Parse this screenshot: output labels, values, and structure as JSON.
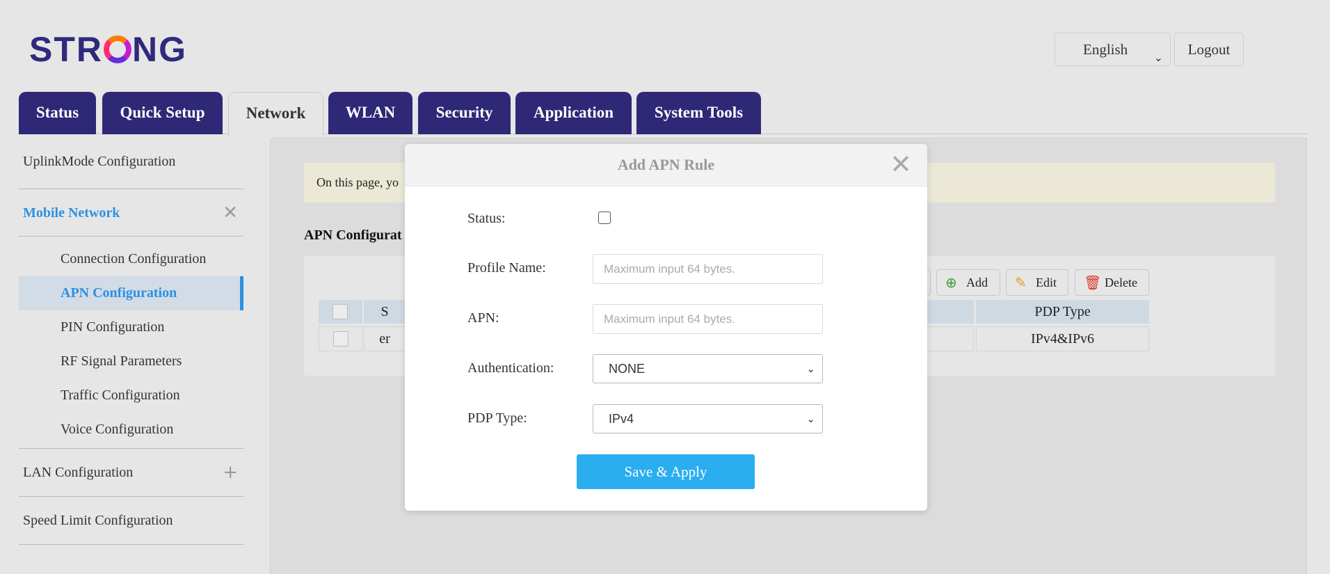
{
  "header": {
    "logo_left": "STR",
    "logo_right": "NG",
    "language": "English",
    "logout": "Logout"
  },
  "tabs": [
    {
      "label": "Status"
    },
    {
      "label": "Quick Setup"
    },
    {
      "label": "Network",
      "active": true
    },
    {
      "label": "WLAN"
    },
    {
      "label": "Security"
    },
    {
      "label": "Application"
    },
    {
      "label": "System Tools"
    }
  ],
  "sidebar": {
    "uplink": "UplinkMode Configuration",
    "mobile_network": "Mobile Network",
    "sub_items": [
      "Connection Configuration",
      "APN Configuration",
      "PIN Configuration",
      "RF Signal Parameters",
      "Traffic Configuration",
      "Voice Configuration"
    ],
    "lan": "LAN Configuration",
    "speed_limit": "Speed Limit Configuration"
  },
  "content": {
    "notice": "On this page, yo",
    "section_title": "APN Configurat",
    "toolbar": {
      "add": "Add",
      "edit": "Edit",
      "delete": "Delete"
    },
    "table": {
      "header_partial": "S",
      "header_pdp": "PDP Type",
      "row_partial": "er",
      "row_pdp": "IPv4&IPv6"
    }
  },
  "modal": {
    "title": "Add APN Rule",
    "status_label": "Status:",
    "status_checked": false,
    "profile_label": "Profile Name:",
    "profile_placeholder": "Maximum input 64 bytes.",
    "apn_label": "APN:",
    "apn_placeholder": "Maximum input 64 bytes.",
    "auth_label": "Authentication:",
    "auth_value": "NONE",
    "pdp_label": "PDP Type:",
    "pdp_value": "IPv4",
    "save": "Save & Apply"
  }
}
